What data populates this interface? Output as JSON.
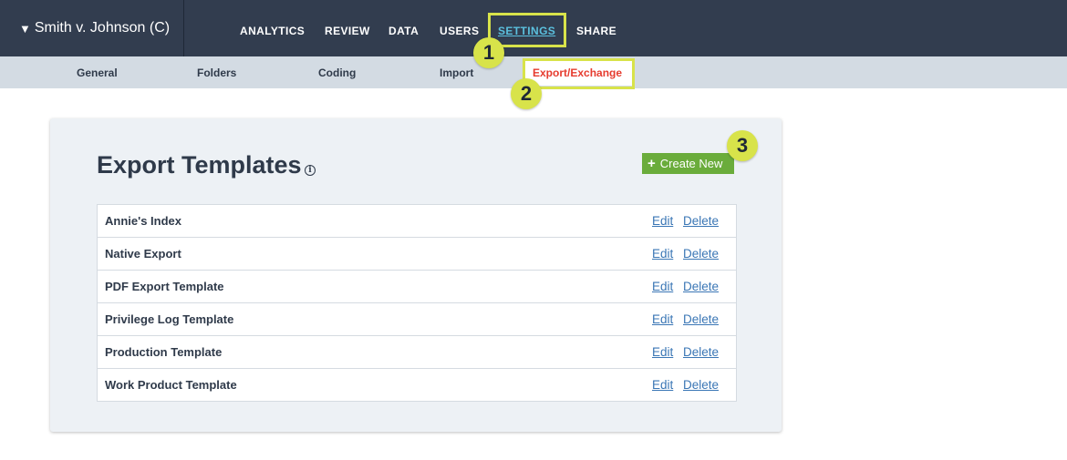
{
  "case": {
    "caret": "▼",
    "title": "Smith v. Johnson (C)"
  },
  "main_nav": [
    {
      "label": "ANALYTICS",
      "active": false
    },
    {
      "label": "REVIEW",
      "active": false
    },
    {
      "label": "DATA",
      "active": false
    },
    {
      "label": "USERS",
      "active": false
    },
    {
      "label": "SETTINGS",
      "active": true
    },
    {
      "label": "SHARE",
      "active": false
    }
  ],
  "sub_nav": [
    {
      "label": "General"
    },
    {
      "label": "Folders"
    },
    {
      "label": "Coding"
    },
    {
      "label": "Import"
    },
    {
      "label": "Export/Exchange",
      "active": true
    }
  ],
  "callouts": [
    "1",
    "2",
    "3"
  ],
  "panel": {
    "title": "Export Templates",
    "info_icon": "i",
    "create_button": {
      "icon": "+",
      "label": "Create New"
    }
  },
  "templates": [
    {
      "name": "Annie's Index",
      "edit": "Edit",
      "delete": "Delete"
    },
    {
      "name": "Native Export",
      "edit": "Edit",
      "delete": "Delete"
    },
    {
      "name": "PDF Export Template",
      "edit": "Edit",
      "delete": "Delete"
    },
    {
      "name": "Privilege Log Template",
      "edit": "Edit",
      "delete": "Delete"
    },
    {
      "name": "Production Template",
      "edit": "Edit",
      "delete": "Delete"
    },
    {
      "name": "Work Product Template",
      "edit": "Edit",
      "delete": "Delete"
    }
  ],
  "colors": {
    "topbar": "#323d4f",
    "subbar": "#d3dbe3",
    "highlight": "#d8e34a",
    "active_nav": "#5bc0de",
    "active_sub": "#e63b2e",
    "create_button": "#6aac3b",
    "link": "#3a76b5"
  }
}
